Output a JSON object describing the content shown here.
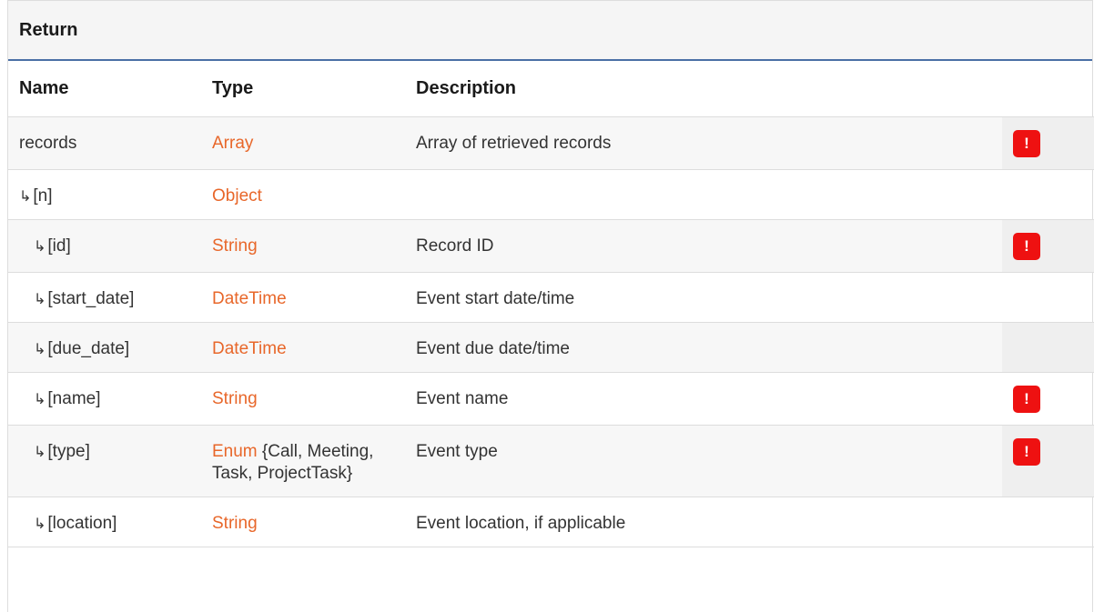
{
  "section": {
    "title": "Return"
  },
  "columns": {
    "name": "Name",
    "type": "Type",
    "description": "Description"
  },
  "rows": [
    {
      "name": "records",
      "type": "Array",
      "type_extra": "",
      "description": "Array of retrieved records",
      "required_mark": "!"
    },
    {
      "name": "[n]",
      "type": "Object",
      "type_extra": "",
      "description": "",
      "required_mark": ""
    },
    {
      "name": "[id]",
      "type": "String",
      "type_extra": "",
      "description": "Record ID",
      "required_mark": "!"
    },
    {
      "name": "[start_date]",
      "type": "DateTime",
      "type_extra": "",
      "description": "Event start date/time",
      "required_mark": ""
    },
    {
      "name": "[due_date]",
      "type": "DateTime",
      "type_extra": "",
      "description": "Event due date/time",
      "required_mark": ""
    },
    {
      "name": "[name]",
      "type": "String",
      "type_extra": "",
      "description": "Event name",
      "required_mark": "!"
    },
    {
      "name": "[type]",
      "type": "Enum",
      "type_extra": " {Call, Meeting, Task, ProjectTask}",
      "description": "Event type",
      "required_mark": "!"
    },
    {
      "name": "[location]",
      "type": "String",
      "type_extra": "",
      "description": "Event location, if applicable",
      "required_mark": ""
    }
  ],
  "icons": {
    "nested_arrow": "return-arrow-icon",
    "required": "required-badge-icon"
  },
  "colors": {
    "type_accent": "#e8672a",
    "required_badge": "#ee1111",
    "header_rule": "#4a6fa5"
  }
}
